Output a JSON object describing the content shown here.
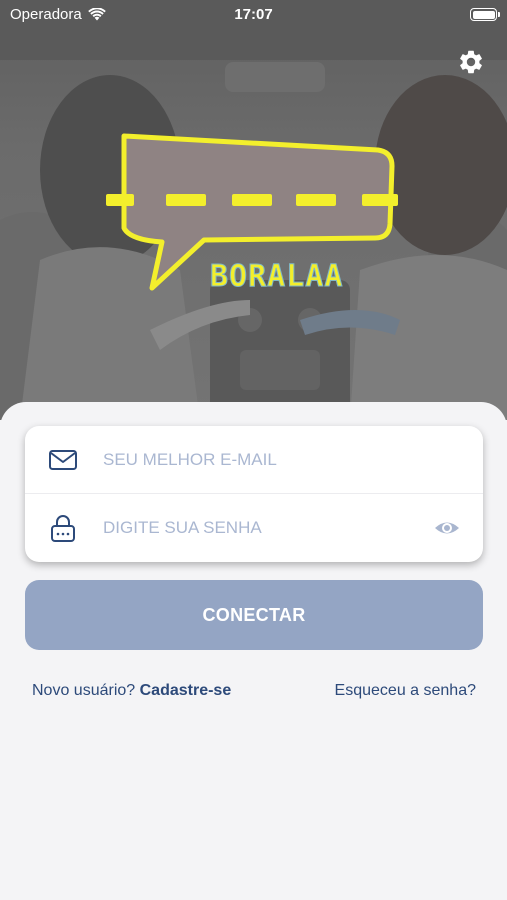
{
  "status_bar": {
    "carrier": "Operadora",
    "time": "17:07"
  },
  "logo": {
    "text": "BORALAA"
  },
  "form": {
    "email_placeholder": "SEU MELHOR E-MAIL",
    "password_placeholder": "DIGITE SUA SENHA"
  },
  "actions": {
    "connect_label": "CONECTAR",
    "new_user_prefix": "Novo usuário?",
    "signup_label": "Cadastre-se",
    "forgot_label": "Esqueceu a senha?"
  },
  "colors": {
    "primary": "#2d4a7a",
    "button": "#94a5c4",
    "logo_yellow": "#f3ef2c"
  },
  "icons": [
    "wifi-icon",
    "battery-icon",
    "gear-icon",
    "mail-icon",
    "lock-icon",
    "eye-icon"
  ]
}
